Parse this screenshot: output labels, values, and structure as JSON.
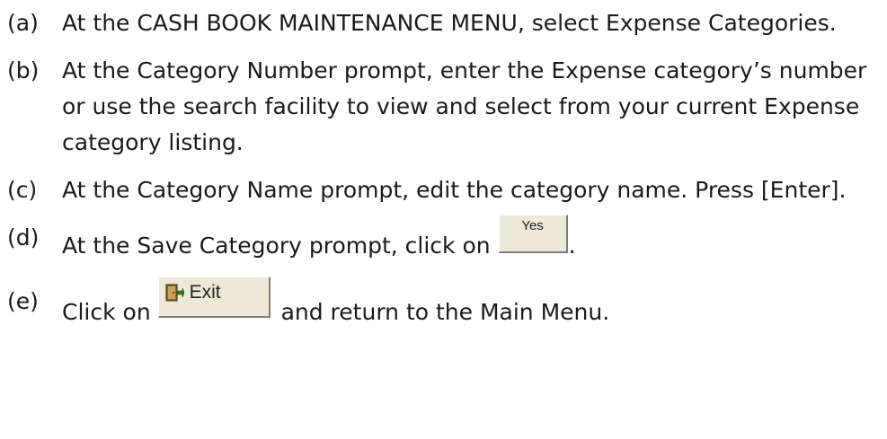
{
  "steps": [
    {
      "marker": "(a)",
      "text": "At the CASH BOOK MAINTENANCE MENU, select Expense Categories."
    },
    {
      "marker": "(b)",
      "text": "At the Category Number prompt, enter the Expense category’s number or use the search facility to view and select from your current Expense category listing."
    },
    {
      "marker": "(c)",
      "text": "At the Category Name prompt, edit the category name. Press [Enter]."
    },
    {
      "marker": "(d)",
      "text_before": "At the Save Category prompt, click on",
      "button_label": "Yes",
      "text_after": "."
    },
    {
      "marker": "(e)",
      "text_before": "Click on",
      "button_label": "Exit",
      "button_icon": "exit-door-icon",
      "text_after": "and return to the Main Menu."
    }
  ]
}
